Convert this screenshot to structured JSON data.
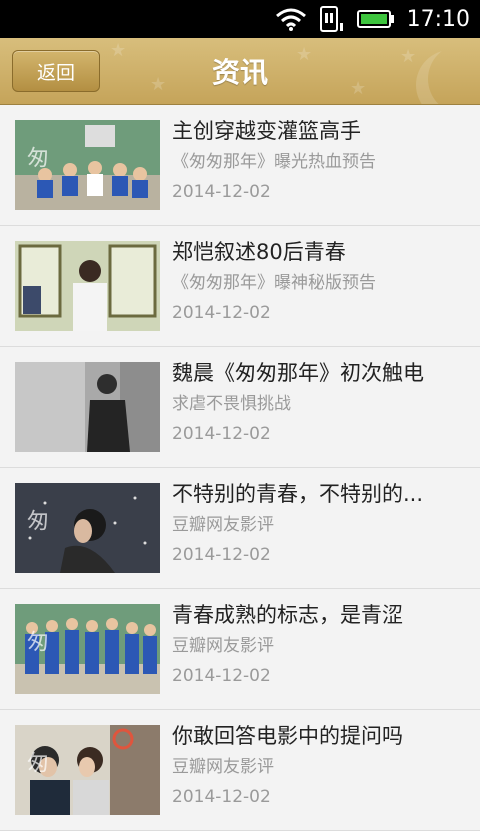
{
  "status": {
    "time": "17:10",
    "icons": [
      "wifi-icon",
      "sim-icon",
      "battery-icon"
    ]
  },
  "header": {
    "back_label": "返回",
    "title": "资讯"
  },
  "news": [
    {
      "title": "主创穿越变灌篮高手",
      "subtitle": "《匆匆那年》曝光热血预告",
      "date": "2014-12-02",
      "overlay": "匆"
    },
    {
      "title": "郑恺叙述80后青春",
      "subtitle": "《匆匆那年》曝神秘版预告",
      "date": "2014-12-02",
      "overlay": ""
    },
    {
      "title": "魏晨《匆匆那年》初次触电",
      "subtitle": "求虐不畏惧挑战",
      "date": "2014-12-02",
      "overlay": ""
    },
    {
      "title": "不特别的青春，不特别的...",
      "subtitle": "豆瓣网友影评",
      "date": "2014-12-02",
      "overlay": "匆"
    },
    {
      "title": "青春成熟的标志，是青涩",
      "subtitle": "豆瓣网友影评",
      "date": "2014-12-02",
      "overlay": "匆"
    },
    {
      "title": "你敢回答电影中的提问吗",
      "subtitle": "豆瓣网友影评",
      "date": "2014-12-02",
      "overlay": "匆"
    }
  ]
}
